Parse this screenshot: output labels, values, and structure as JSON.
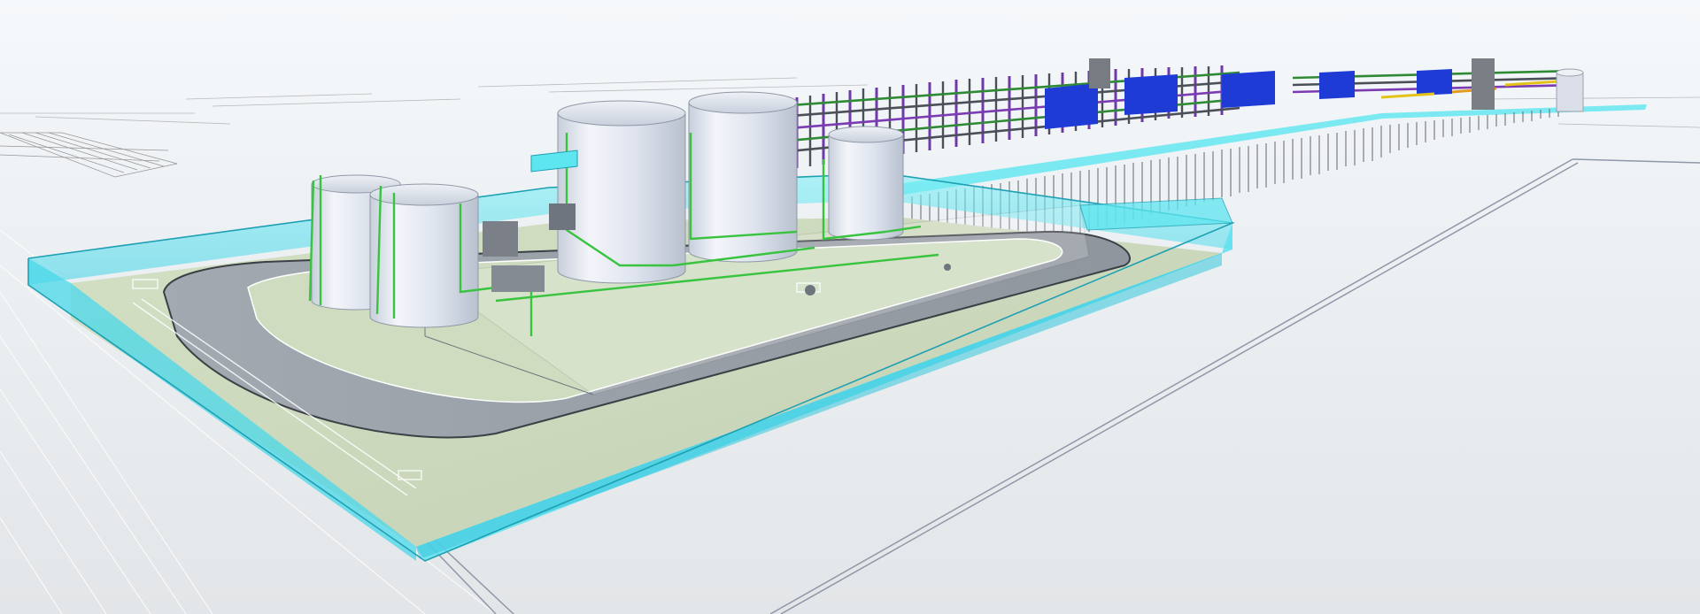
{
  "viewport": {
    "kind": "3d-plant-model"
  },
  "colors": {
    "background": "#e9eef2",
    "containment_wall": "#5ee6f0",
    "containment_edge": "#1ea0b3",
    "ground_pad": "#c9d6b8",
    "road": "#9aa1a9",
    "tank": "#dde2ec",
    "pipe_green": "#38c43f",
    "pipe_purple": "#7b3bb3",
    "pipe_blue": "#1f3bd6",
    "piles": "#7d7f83"
  },
  "icons": {
    "tank": "storage-tank-icon"
  }
}
